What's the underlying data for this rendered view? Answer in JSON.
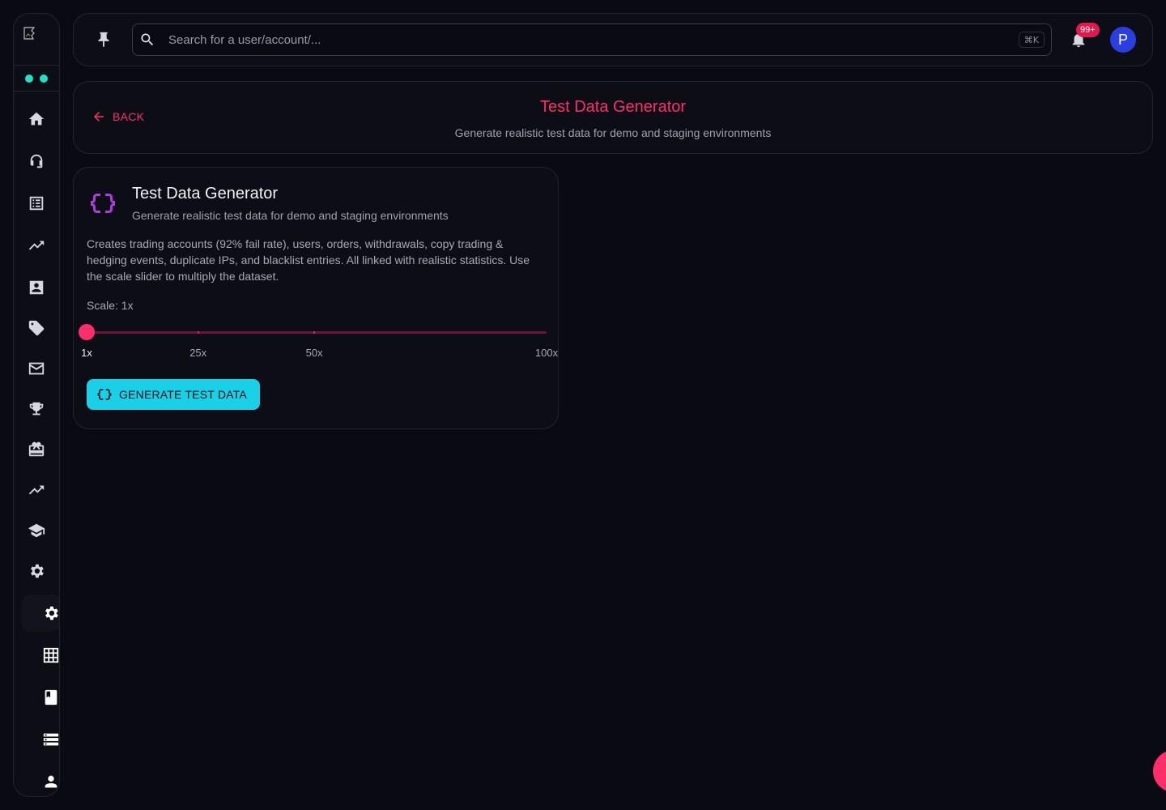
{
  "search": {
    "placeholder": "Search for a user/account/...",
    "shortcut": "⌘K"
  },
  "notifications": {
    "badge": "99+"
  },
  "user": {
    "avatar_initial": "P"
  },
  "header": {
    "back_label": "BACK",
    "title": "Test Data Generator",
    "subtitle": "Generate realistic test data for demo and staging environments"
  },
  "generator": {
    "title": "Test Data Generator",
    "subtitle": "Generate realistic test data for demo and staging environments",
    "description": "Creates trading accounts (92% fail rate), users, orders, withdrawals, copy trading & hedging events, duplicate IPs, and blacklist entries. All linked with realistic statistics. Use the scale slider to multiply the dataset.",
    "scale_label": "Scale: 1x",
    "slider": {
      "min": 1,
      "max": 100,
      "value": 1,
      "marks": [
        {
          "value": 1,
          "label": "1x"
        },
        {
          "value": 25,
          "label": "25x"
        },
        {
          "value": 50,
          "label": "50x"
        },
        {
          "value": 100,
          "label": "100x"
        }
      ]
    },
    "button_label": "GENERATE TEST DATA"
  },
  "colors": {
    "accent": "#ff2d6a",
    "button": "#1ad0e6",
    "status_dot": "#1ee3c9",
    "icon_purple": "#b13be0",
    "avatar": "#2b3fe0"
  },
  "sidebar": {
    "items": [
      {
        "icon": "home-icon"
      },
      {
        "icon": "support-agent-icon"
      },
      {
        "icon": "list-icon"
      },
      {
        "icon": "trending-up-icon"
      },
      {
        "icon": "contact-card-icon"
      },
      {
        "icon": "tag-icon"
      },
      {
        "icon": "mail-icon"
      },
      {
        "icon": "trophy-icon"
      },
      {
        "icon": "gift-card-icon"
      },
      {
        "icon": "trending-up-icon"
      },
      {
        "icon": "school-icon"
      },
      {
        "icon": "settings-icon"
      }
    ],
    "sub_items": [
      {
        "icon": "settings-icon",
        "active": true
      },
      {
        "icon": "grid-icon"
      },
      {
        "icon": "book-icon"
      },
      {
        "icon": "storage-icon"
      },
      {
        "icon": "person-icon"
      }
    ]
  }
}
